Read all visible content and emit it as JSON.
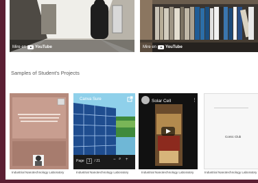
{
  "videos": [
    {
      "watch_on": "Mire en",
      "platform": "YouTube"
    },
    {
      "watch_on": "Mire en",
      "platform": "YouTube"
    }
  ],
  "section_title": "Samples of Student's Projects",
  "projects": [
    {
      "caption": "Industrial Nanotechnology Laboratory"
    },
    {
      "caption": "Industrial Nanotechnology Laboratory",
      "tab_title": "Canva Sure",
      "page_label": "Page",
      "page_number": "1",
      "page_total": "/ 21"
    },
    {
      "caption": "Industrial Nanotechnology Laboratory",
      "title": "Solar Cell"
    },
    {
      "caption": "Industrial Nanotechnology Laboratory",
      "title": "Comic Club"
    }
  ],
  "colors": {
    "outer_bg": "#5b1f33",
    "content_bg": "#ffffff"
  }
}
